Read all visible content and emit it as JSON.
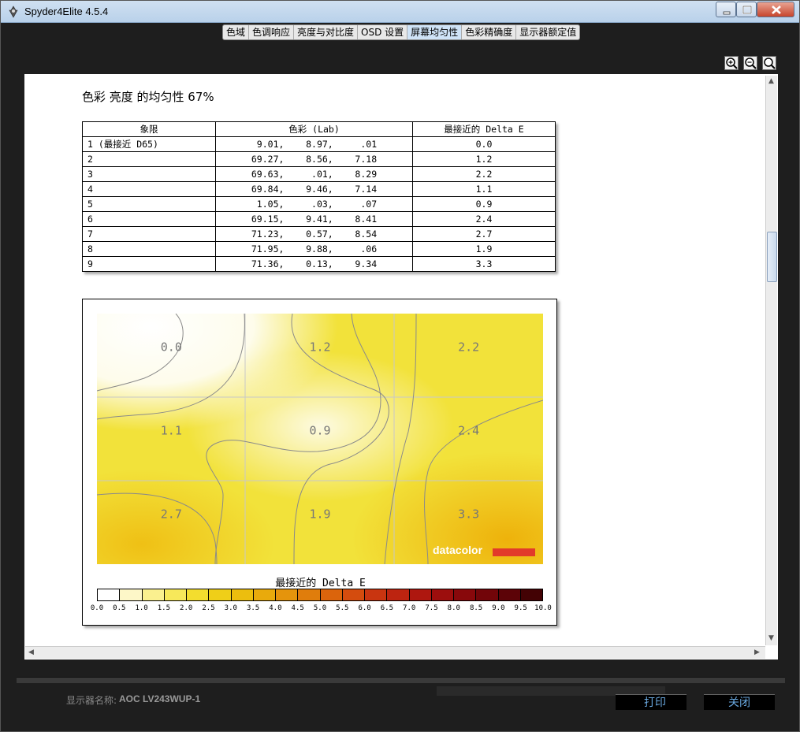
{
  "window": {
    "title": "Spyder4Elite 4.5.4"
  },
  "tabs": [
    {
      "label": "色域",
      "active": false
    },
    {
      "label": "色调响应",
      "active": false
    },
    {
      "label": "亮度与对比度",
      "active": false
    },
    {
      "label": "OSD 设置",
      "active": false
    },
    {
      "label": "屏幕均匀性",
      "active": true
    },
    {
      "label": "色彩精确度",
      "active": false
    },
    {
      "label": "显示器额定值",
      "active": false
    }
  ],
  "report": {
    "title": "色彩 亮度 的均匀性 67%",
    "table": {
      "headers": [
        "象限",
        "色彩 (Lab)",
        "最接近的 Delta E"
      ],
      "rows": [
        [
          "1 (最接近 D65)",
          " 9.01,    8.97,     .01",
          "0.0"
        ],
        [
          "2",
          "69.27,    8.56,    7.18",
          "1.2"
        ],
        [
          "3",
          "69.63,     .01,    8.29",
          "2.2"
        ],
        [
          "4",
          "69.84,    9.46,    7.14",
          "1.1"
        ],
        [
          "5",
          " 1.05,     .03,     .07",
          "0.9"
        ],
        [
          "6",
          "69.15,    9.41,    8.41",
          "2.4"
        ],
        [
          "7",
          "71.23,    0.57,    8.54",
          "2.7"
        ],
        [
          "8",
          "71.95,    9.88,     .06",
          "1.9"
        ],
        [
          "9",
          "71.36,    0.13,    9.34",
          "3.3"
        ]
      ]
    },
    "legend_title": "最接近的 Delta E",
    "brand": "datacolor"
  },
  "chart_data": {
    "type": "heatmap",
    "title": "最接近的 Delta E",
    "rows": 3,
    "cols": 3,
    "values": [
      [
        0.0,
        1.2,
        2.2
      ],
      [
        1.1,
        0.9,
        2.4
      ],
      [
        2.7,
        1.9,
        3.3
      ]
    ],
    "cell_labels": [
      [
        "0.0",
        "1.2",
        "2.2"
      ],
      [
        "1.1",
        "0.9",
        "2.4"
      ],
      [
        "2.7",
        "1.9",
        "3.3"
      ]
    ],
    "scale_ticks": [
      "0.0",
      "0.5",
      "1.0",
      "1.5",
      "2.0",
      "2.5",
      "3.0",
      "3.5",
      "4.0",
      "4.5",
      "5.0",
      "5.5",
      "6.0",
      "6.5",
      "7.0",
      "7.5",
      "8.0",
      "8.5",
      "9.0",
      "9.5",
      "10.0"
    ],
    "scale_range": [
      0,
      10
    ],
    "scale_colors": [
      "#ffffff",
      "#fdf7c8",
      "#faf08f",
      "#f7e85a",
      "#f3dd2e",
      "#efcf18",
      "#ecbe0e",
      "#e9aa0c",
      "#e5940c",
      "#e07d0c",
      "#db640c",
      "#d44c0e",
      "#c93510",
      "#bd2410",
      "#ae170f",
      "#9c0e0d",
      "#88080b",
      "#720509",
      "#5c0307",
      "#430204"
    ]
  },
  "footer": {
    "monitor_label": "显示器名称:",
    "monitor_name": "AOC LV243WUP-1",
    "print_label": "打印",
    "close_label": "关闭"
  }
}
